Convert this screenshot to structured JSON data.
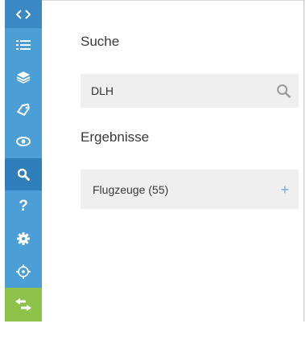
{
  "sidebar": {
    "items": [
      {
        "icon": "code-toggle-icon"
      },
      {
        "icon": "list-icon"
      },
      {
        "icon": "layers-icon"
      },
      {
        "icon": "tags-icon"
      },
      {
        "icon": "eye-icon"
      },
      {
        "icon": "search-icon"
      },
      {
        "icon": "help-icon",
        "label": "?"
      },
      {
        "icon": "gear-icon"
      },
      {
        "icon": "crosshair-icon"
      },
      {
        "icon": "swap-arrows-icon"
      }
    ],
    "accent_color": "#4b9ed6",
    "active_color": "#2f7db9",
    "bottom_color": "#8ec24a"
  },
  "search": {
    "heading": "Suche",
    "value": "DLH",
    "placeholder": ""
  },
  "results": {
    "heading": "Ergebnisse",
    "items": [
      {
        "label": "Flugzeuge (55)",
        "action_icon": "plus-icon"
      }
    ]
  }
}
